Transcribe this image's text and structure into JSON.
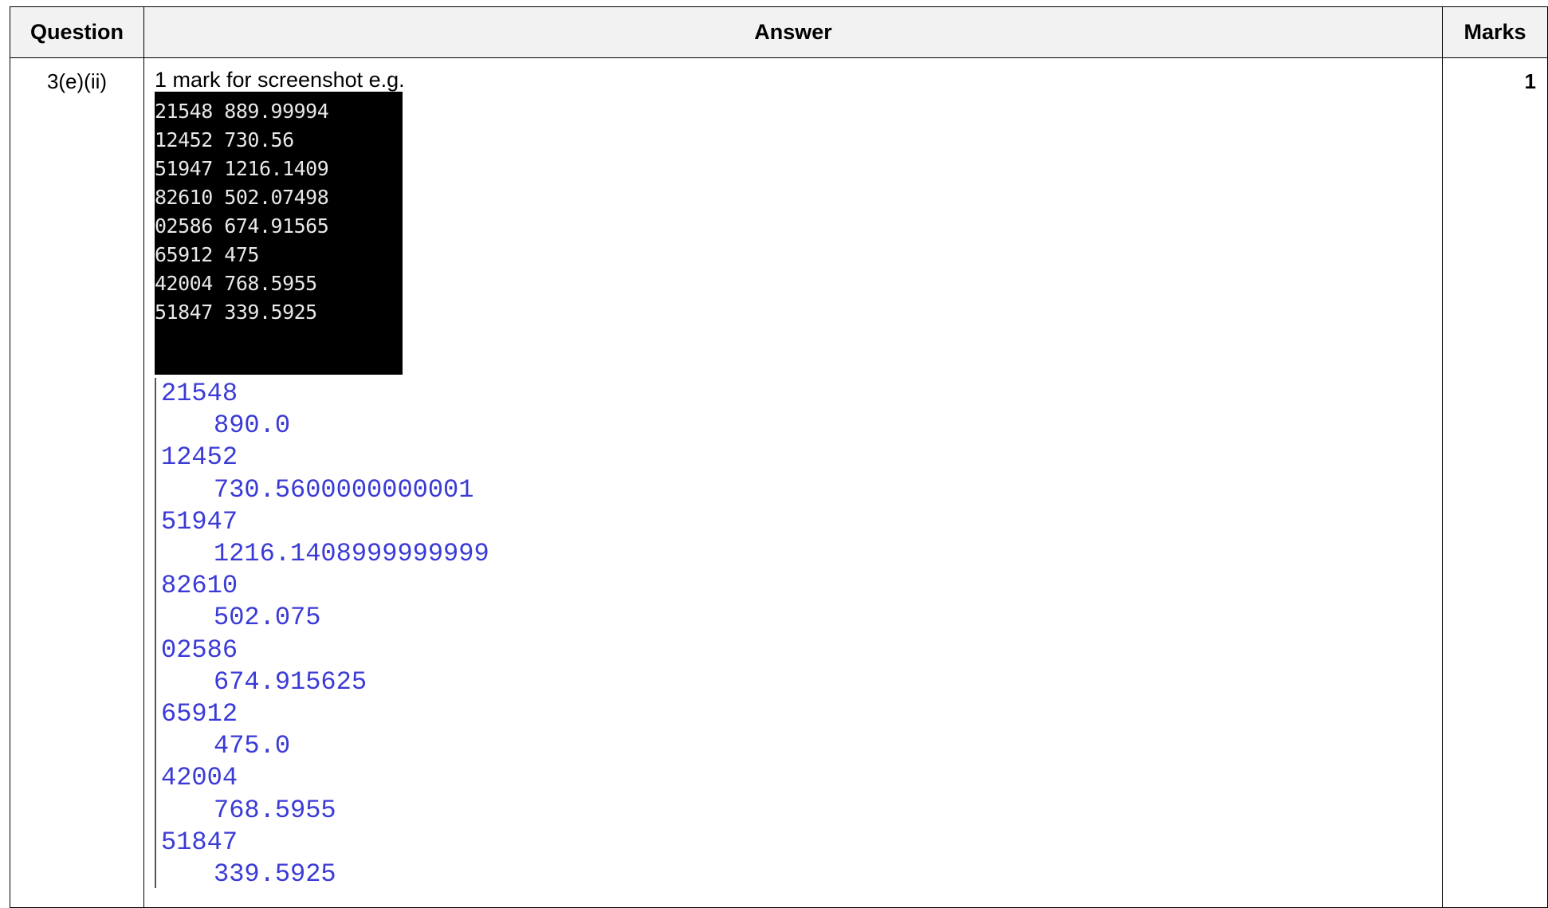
{
  "table": {
    "headers": {
      "question": "Question",
      "answer": "Answer",
      "marks": "Marks"
    },
    "row": {
      "question": "3(e)(ii)",
      "intro": "1 mark for screenshot e.g.",
      "marks": "1",
      "console_output": [
        "21548 889.99994",
        "12452 730.56",
        "51947 1216.1409",
        "82610 502.07498",
        "02586 674.91565",
        "65912 475",
        "42004 768.5955",
        "51847 339.5925"
      ],
      "shell_output": [
        "21548",
        "890.0",
        "12452",
        "730.5600000000001",
        "51947",
        "1216.1408999999999",
        "82610",
        "502.075",
        "02586",
        "674.915625",
        "65912",
        "475.0",
        "42004",
        "768.5955",
        "51847",
        "339.5925"
      ]
    }
  },
  "colors": {
    "header_bg": "#f2f2f2",
    "console_bg": "#000000",
    "console_text": "#e8e8e8",
    "shell_text": "#3a3ad6"
  }
}
